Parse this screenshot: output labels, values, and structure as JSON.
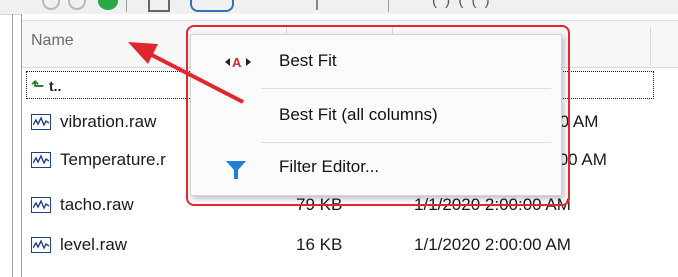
{
  "toolbar": {
    "partial_text": "( ) ( ( )"
  },
  "columns": {
    "name": "Name"
  },
  "parent_row": {
    "icon": "up-folder-icon",
    "label": "t.."
  },
  "files": [
    {
      "name": "vibration.raw",
      "size": "",
      "date": ":00 AM"
    },
    {
      "name": "Temperature.r",
      "size": "",
      "date": ":00 AM"
    },
    {
      "name": "tacho.raw",
      "size": "79 KB",
      "date": "1/1/2020 2:00:00 AM"
    },
    {
      "name": "level.raw",
      "size": "16 KB",
      "date": "1/1/2020 2:00:00 AM"
    }
  ],
  "file_row_date_fragment_2": "2:00 AM",
  "context_menu": {
    "items": [
      {
        "label": "Best Fit",
        "icon": "best-fit-icon"
      },
      {
        "label": "Best Fit (all columns)",
        "icon": ""
      },
      {
        "label": "Filter Editor...",
        "icon": "filter-icon"
      }
    ]
  },
  "colors": {
    "annotation_red": "#e0272d",
    "filter_blue": "#1e7fd6",
    "file_icon_blue": "#1f3f8f"
  }
}
